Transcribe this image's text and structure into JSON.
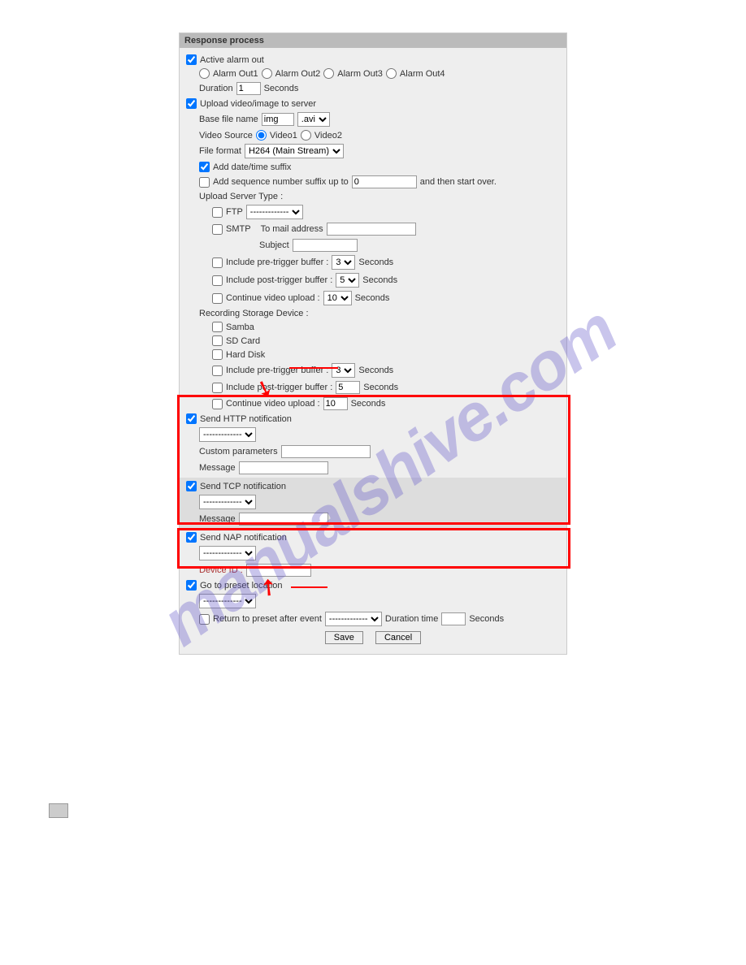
{
  "header": "Response process",
  "activeAlarm": {
    "label": "Active alarm out",
    "opts": [
      "Alarm Out1",
      "Alarm Out2",
      "Alarm Out3",
      "Alarm Out4"
    ],
    "durLabel": "Duration",
    "durVal": "1",
    "durUnit": "Seconds"
  },
  "upload": {
    "label": "Upload video/image to server",
    "baseLabel": "Base file name",
    "baseVal": "img",
    "baseExt": ".avi",
    "vsLabel": "Video Source",
    "vsOpts": [
      "Video1",
      "Video2"
    ],
    "ffLabel": "File format",
    "ffVal": "H264 (Main Stream)",
    "dtSuffix": "Add date/time suffix",
    "seqLabel": "Add sequence number suffix up to",
    "seqVal": "0",
    "seqAfter": "and then start over.",
    "ustLabel": "Upload Server Type :",
    "ftp": "FTP",
    "ftpSel": "-------------",
    "smtp": "SMTP",
    "toMail": "To mail address",
    "subject": "Subject",
    "preBuf": "Include pre-trigger buffer :",
    "preVal": "3",
    "postBuf": "Include post-trigger buffer :",
    "postVal": "5",
    "contUp": "Continue video upload :",
    "contVal": "10",
    "sec": "Seconds",
    "rsdLabel": "Recording Storage Device :",
    "samba": "Samba",
    "sd": "SD Card",
    "hdd": "Hard Disk",
    "preBuf2Val": "3",
    "postBuf2Val": "5",
    "contVal2": "10"
  },
  "http": {
    "label": "Send HTTP notification",
    "sel": "-------------",
    "custom": "Custom parameters",
    "msg": "Message"
  },
  "tcp": {
    "label": "Send TCP notification",
    "sel": "-------------",
    "msg": "Message"
  },
  "nap": {
    "label": "Send NAP notification",
    "sel": "-------------",
    "devId": "Device ID :"
  },
  "preset": {
    "label": "Go to preset location",
    "sel": "-------------",
    "ret": "Return to preset after event",
    "retSel": "-------------",
    "durTime": "Duration time",
    "sec": "Seconds"
  },
  "buttons": {
    "save": "Save",
    "cancel": "Cancel"
  }
}
